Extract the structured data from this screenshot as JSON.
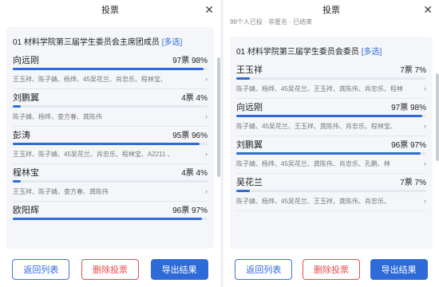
{
  "left": {
    "title": "投票",
    "close": "✕",
    "question": {
      "prefix": "01",
      "text": "材料学院第三届学生委员会主席团成员",
      "tag": "[多选]"
    },
    "options": [
      {
        "name": "向远刚",
        "votes": "97票",
        "percent": "98%",
        "fill": 0.98,
        "voters": "王玉祥、陈子婧、杨烨、45吴花兰、肖忠乐、程林宝、"
      },
      {
        "name": "刘鹏翼",
        "votes": "4票",
        "percent": "4%",
        "fill": 0.04,
        "voters": "陈子婧、杨烨、查方春、龚陈伟"
      },
      {
        "name": "彭涛",
        "votes": "95票",
        "percent": "96%",
        "fill": 0.96,
        "voters": "王玉祥、陈子婧、45吴花兰、肖忠乐、程林宝、A2211 、"
      },
      {
        "name": "程林宝",
        "votes": "4票",
        "percent": "4%",
        "fill": 0.04,
        "voters": "王玉祥、陈子婧、查方春、龚陈伟"
      },
      {
        "name": "欧阳辉",
        "votes": "96票",
        "percent": "97%",
        "fill": 0.97,
        "voters": ""
      }
    ],
    "buttons": {
      "back": "返回列表",
      "delete": "删除投票",
      "export": "导出结果"
    }
  },
  "right": {
    "title": "投票",
    "close": "✕",
    "status": "98个人已投 · 非匿名 · 已结束",
    "question": {
      "prefix": "01",
      "text": "材料学院第三届学生委员会委员",
      "tag": "[多选]"
    },
    "options": [
      {
        "name": "王玉祥",
        "votes": "7票",
        "percent": "7%",
        "fill": 0.07,
        "voters": "陈子婧、杨烨、45吴花兰、王玉祥、龚陈伟、肖忠乐、程林"
      },
      {
        "name": "向远刚",
        "votes": "97票",
        "percent": "98%",
        "fill": 0.98,
        "voters": "陈子婧、45吴花兰、王玉祥、龚陈伟、肖忠乐、程林宝、"
      },
      {
        "name": "刘鹏翼",
        "votes": "96票",
        "percent": "97%",
        "fill": 0.97,
        "voters": "陈子婧、杨烨、45吴花兰、龚陈伟、肖忠乐、孔鹏、林"
      },
      {
        "name": "吴花兰",
        "votes": "7票",
        "percent": "7%",
        "fill": 0.07,
        "voters": "陈子婧、杨烨、45吴花兰、王玉祥、龚陈伟、肖忠乐、"
      }
    ],
    "buttons": {
      "back": "返回列表",
      "delete": "删除投票",
      "export": "导出结果"
    }
  },
  "colors": {
    "accent": "#2f6bd8",
    "danger": "#e54c4c"
  }
}
